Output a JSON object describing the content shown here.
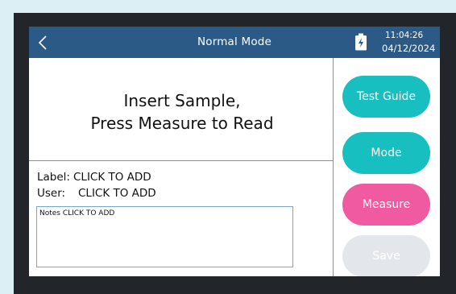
{
  "header": {
    "title": "Normal Mode",
    "time": "11:04:26",
    "date": "04/12/2024",
    "back_icon": "chevron-left-icon",
    "battery_icon": "battery-charging-icon"
  },
  "prompt": {
    "line1": "Insert Sample,",
    "line2": "Press Measure to Read"
  },
  "meta": {
    "label_key": "Label:",
    "label_value": "CLICK TO ADD",
    "user_key": "User:",
    "user_value": "CLICK TO ADD",
    "notes": "Notes CLICK TO ADD"
  },
  "buttons": {
    "test_guide": "Test Guide",
    "mode": "Mode",
    "measure": "Measure",
    "save": "Save"
  },
  "colors": {
    "header_bg": "#2c5a87",
    "teal": "#17bfc0",
    "pink": "#ef5aa0",
    "disabled": "#e3e7eb",
    "bezel": "#222529",
    "backdrop": "#dbeff5"
  }
}
